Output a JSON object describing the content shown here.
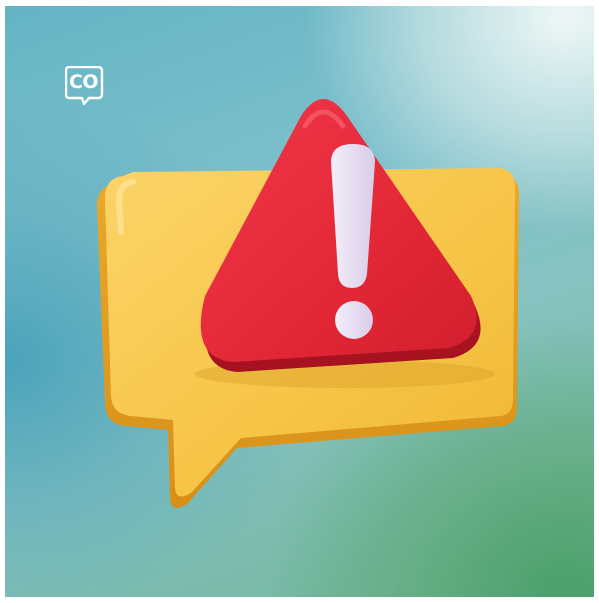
{
  "logo": {
    "text": "CO",
    "icon": "speech-bubble-logo-icon",
    "color": "#ffffff"
  },
  "illustration": {
    "subject": "warning-triangle-on-chat-bubble",
    "bubble_color": "#f6c445",
    "triangle_color": "#e8283a",
    "exclamation_color": "#e9e0f2"
  }
}
